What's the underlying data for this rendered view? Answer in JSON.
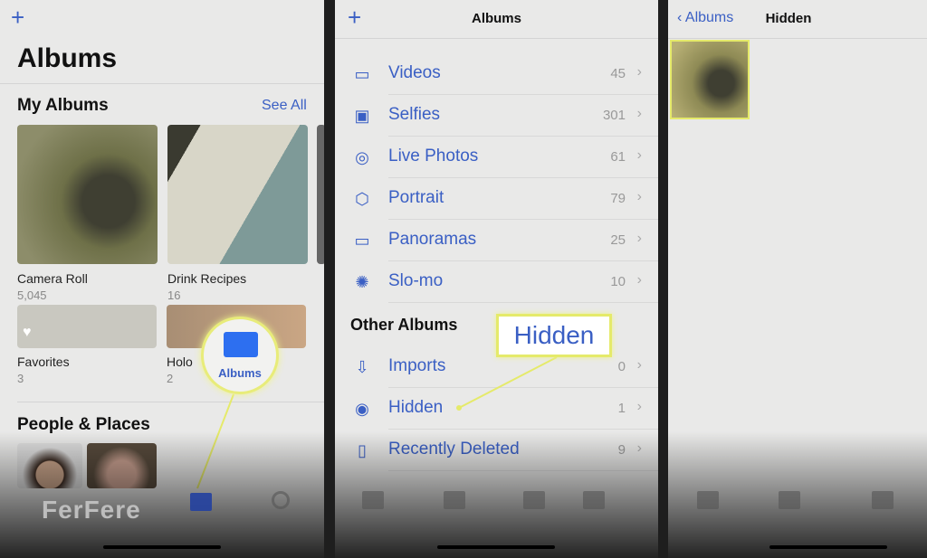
{
  "panel1": {
    "add_icon": "plus-icon",
    "title": "Albums",
    "my_albums": {
      "heading": "My Albums",
      "see_all": "See All",
      "albums": [
        {
          "name": "Camera Roll",
          "count": "5,045"
        },
        {
          "name": "Drink Recipes",
          "count": "16"
        },
        {
          "name": "Favorites",
          "count": "3"
        },
        {
          "name": "Holo",
          "count": "2"
        }
      ]
    },
    "people_heading": "People & Places",
    "callout_label": "Albums",
    "watermark": "FerFere"
  },
  "panel2": {
    "nav_title": "Albums",
    "media_types": [
      {
        "name": "Videos",
        "count": "45",
        "icon": "video-icon"
      },
      {
        "name": "Selfies",
        "count": "301",
        "icon": "selfie-icon"
      },
      {
        "name": "Live Photos",
        "count": "61",
        "icon": "live-photo-icon"
      },
      {
        "name": "Portrait",
        "count": "79",
        "icon": "cube-icon"
      },
      {
        "name": "Panoramas",
        "count": "25",
        "icon": "panorama-icon"
      },
      {
        "name": "Slo-mo",
        "count": "10",
        "icon": "slomo-icon"
      }
    ],
    "other_heading": "Other Albums",
    "other_albums": [
      {
        "name": "Imports",
        "count": "0",
        "icon": "import-icon"
      },
      {
        "name": "Hidden",
        "count": "1",
        "icon": "eye-slash-icon"
      },
      {
        "name": "Recently Deleted",
        "count": "9",
        "icon": "trash-icon"
      }
    ],
    "callout_label": "Hidden"
  },
  "panel3": {
    "back_label": "Albums",
    "nav_title": "Hidden"
  },
  "colors": {
    "accent": "#3a5fc4",
    "highlight": "#e5ea6a"
  }
}
